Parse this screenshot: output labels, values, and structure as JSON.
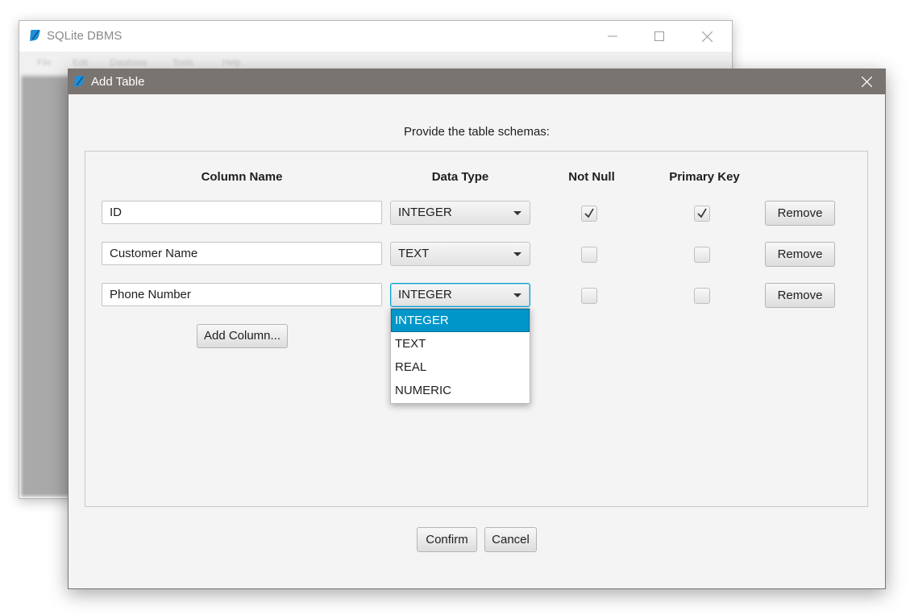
{
  "main_window": {
    "title": "SQLite DBMS",
    "menu": [
      "File",
      "Edit",
      "Database",
      "Tools",
      "Help"
    ]
  },
  "dialog": {
    "title": "Add Table",
    "prompt": "Provide the table schemas:",
    "headers": {
      "column_name": "Column Name",
      "data_type": "Data Type",
      "not_null": "Not Null",
      "primary_key": "Primary Key"
    },
    "rows": [
      {
        "name": "ID",
        "type": "INTEGER",
        "not_null": true,
        "primary_key": true,
        "remove_label": "Remove"
      },
      {
        "name": "Customer Name",
        "type": "TEXT",
        "not_null": false,
        "primary_key": false,
        "remove_label": "Remove"
      },
      {
        "name": "Phone Number",
        "type": "INTEGER",
        "not_null": false,
        "primary_key": false,
        "remove_label": "Remove"
      }
    ],
    "add_column_label": "Add Column...",
    "type_options": [
      "INTEGER",
      "TEXT",
      "REAL",
      "NUMERIC"
    ],
    "selected_option": "INTEGER",
    "confirm_label": "Confirm",
    "cancel_label": "Cancel"
  },
  "colors": {
    "dialog_titlebar": "#7a7471",
    "selection": "#0096c9",
    "focus_border": "#039ed3"
  }
}
